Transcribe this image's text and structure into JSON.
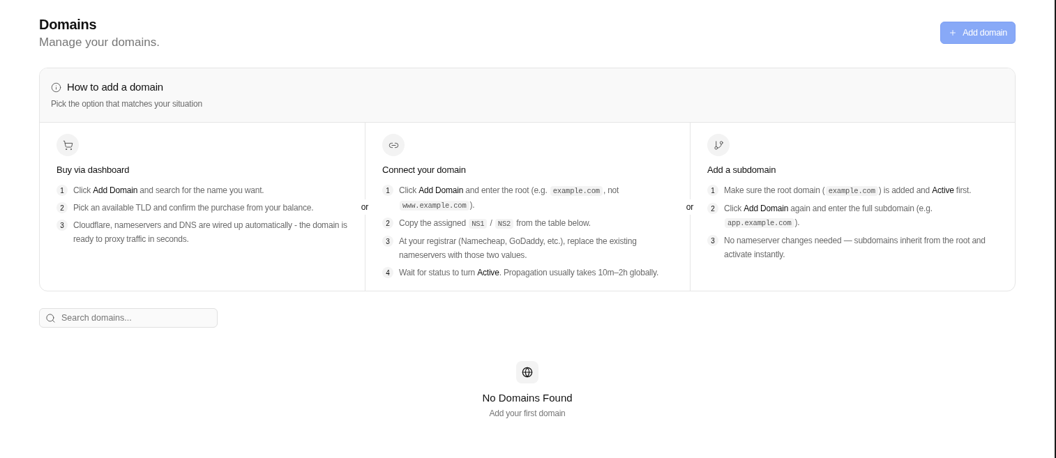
{
  "page": {
    "title": "Domains",
    "subtitle": "Manage your domains."
  },
  "add_button": {
    "label": "Add domain"
  },
  "guide": {
    "title": "How to add a domain",
    "subtitle": "Pick the option that matches your situation",
    "options": [
      {
        "kind": "cart",
        "title": "Buy via dashboard",
        "steps": [
          {
            "number": "1",
            "parts": [
              {
                "kind": "text",
                "text": "Click "
              },
              {
                "kind": "strong",
                "text": "Add Domain"
              },
              {
                "kind": "text",
                "text": " and search for the name you want."
              }
            ]
          },
          {
            "number": "2",
            "parts": [
              {
                "kind": "text",
                "text": "Pick an available TLD and confirm the purchase from your balance."
              }
            ]
          },
          {
            "number": "3",
            "parts": [
              {
                "kind": "text",
                "text": "Cloudflare, nameservers and DNS are wired up automatically - the domain is ready to proxy traffic in seconds."
              }
            ]
          }
        ]
      },
      {
        "kind": "link",
        "title": "Connect your domain",
        "steps": [
          {
            "number": "1",
            "parts": [
              {
                "kind": "text",
                "text": "Click "
              },
              {
                "kind": "strong",
                "text": "Add Domain"
              },
              {
                "kind": "text",
                "text": " and enter the root (e.g. "
              },
              {
                "kind": "code",
                "text": "example.com"
              },
              {
                "kind": "text",
                "text": ", not "
              },
              {
                "kind": "code",
                "text": "www.example.com"
              },
              {
                "kind": "text",
                "text": ")."
              }
            ]
          },
          {
            "number": "2",
            "parts": [
              {
                "kind": "text",
                "text": "Copy the assigned "
              },
              {
                "kind": "code",
                "text": "NS1"
              },
              {
                "kind": "text",
                "text": " / "
              },
              {
                "kind": "code",
                "text": "NS2"
              },
              {
                "kind": "text",
                "text": " from the table below."
              }
            ]
          },
          {
            "number": "3",
            "parts": [
              {
                "kind": "text",
                "text": "At your registrar (Namecheap, GoDaddy, etc.), replace the existing nameservers with those two values."
              }
            ]
          },
          {
            "number": "4",
            "parts": [
              {
                "kind": "text",
                "text": "Wait for status to turn "
              },
              {
                "kind": "strong",
                "text": "Active"
              },
              {
                "kind": "text",
                "text": ". Propagation usually takes 10m–2h globally."
              }
            ]
          }
        ]
      },
      {
        "kind": "branch",
        "title": "Add a subdomain",
        "steps": [
          {
            "number": "1",
            "parts": [
              {
                "kind": "text",
                "text": "Make sure the root domain ("
              },
              {
                "kind": "code",
                "text": "example.com"
              },
              {
                "kind": "text",
                "text": ") is added and "
              },
              {
                "kind": "strong",
                "text": "Active"
              },
              {
                "kind": "text",
                "text": " first."
              }
            ]
          },
          {
            "number": "2",
            "parts": [
              {
                "kind": "text",
                "text": "Click "
              },
              {
                "kind": "strong",
                "text": "Add Domain"
              },
              {
                "kind": "text",
                "text": " again and enter the full subdomain (e.g. "
              },
              {
                "kind": "code",
                "text": "app.example.com"
              },
              {
                "kind": "text",
                "text": ")."
              }
            ]
          },
          {
            "number": "3",
            "parts": [
              {
                "kind": "text",
                "text": "No nameserver changes needed — subdomains inherit from the root and activate instantly."
              }
            ]
          }
        ]
      }
    ],
    "separators": [
      "or",
      "or"
    ]
  },
  "search": {
    "placeholder": "Search domains..."
  },
  "empty_state": {
    "title": "No Domains Found",
    "message": "Add your first domain"
  }
}
